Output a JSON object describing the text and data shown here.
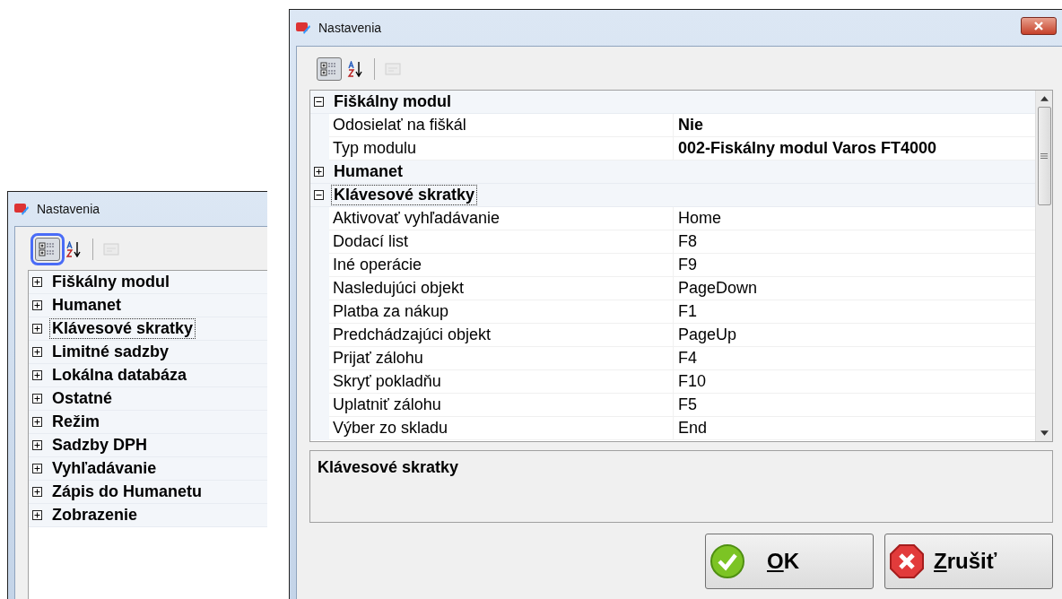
{
  "windows": [
    {
      "title": "Nastavenia",
      "toolbar": [
        {
          "kind": "categorized",
          "selected": true,
          "highlighted": true,
          "disabled": false
        },
        {
          "kind": "alphabetical",
          "selected": false,
          "highlighted": false,
          "disabled": false
        },
        {
          "kind": "pages",
          "selected": false,
          "highlighted": false,
          "disabled": true
        }
      ],
      "categories": [
        {
          "name": "Fiškálny modul",
          "expanded": false,
          "selected": false
        },
        {
          "name": "Humanet",
          "expanded": false,
          "selected": false
        },
        {
          "name": "Klávesové skratky",
          "expanded": false,
          "selected": true
        },
        {
          "name": "Limitné sadzby",
          "expanded": false,
          "selected": false
        },
        {
          "name": "Lokálna databáza",
          "expanded": false,
          "selected": false
        },
        {
          "name": "Ostatné",
          "expanded": false,
          "selected": false
        },
        {
          "name": "Režim",
          "expanded": false,
          "selected": false
        },
        {
          "name": "Sadzby DPH",
          "expanded": false,
          "selected": false
        },
        {
          "name": "Vyhľadávanie",
          "expanded": false,
          "selected": false
        },
        {
          "name": "Zápis do Humanetu",
          "expanded": false,
          "selected": false
        },
        {
          "name": "Zobrazenie",
          "expanded": false,
          "selected": false
        }
      ]
    },
    {
      "title": "Nastavenia",
      "toolbar": [
        {
          "kind": "categorized",
          "selected": true,
          "highlighted": false,
          "disabled": false
        },
        {
          "kind": "alphabetical",
          "selected": false,
          "highlighted": false,
          "disabled": false
        },
        {
          "kind": "pages",
          "selected": false,
          "highlighted": false,
          "disabled": true
        }
      ],
      "categories": [
        {
          "name": "Fiškálny modul",
          "expanded": true,
          "selected": false,
          "properties": [
            {
              "name": "Odosielať na fiškál",
              "value": "Nie",
              "modified": true
            },
            {
              "name": "Typ modulu",
              "value": "002-Fiskálny modul Varos FT4000",
              "modified": true
            }
          ]
        },
        {
          "name": "Humanet",
          "expanded": false,
          "selected": false
        },
        {
          "name": "Klávesové skratky",
          "expanded": true,
          "selected": true,
          "properties": [
            {
              "name": "Aktivovať vyhľadávanie",
              "value": "Home",
              "modified": false
            },
            {
              "name": "Dodací list",
              "value": "F8",
              "modified": false
            },
            {
              "name": "Iné operácie",
              "value": "F9",
              "modified": false
            },
            {
              "name": "Nasledujúci objekt",
              "value": "PageDown",
              "modified": false
            },
            {
              "name": "Platba za nákup",
              "value": "F1",
              "modified": false
            },
            {
              "name": "Predchádzajúci objekt",
              "value": "PageUp",
              "modified": false
            },
            {
              "name": "Prijať zálohu",
              "value": "F4",
              "modified": false
            },
            {
              "name": "Skryť pokladňu",
              "value": "F10",
              "modified": false
            },
            {
              "name": "Uplatniť zálohu",
              "value": "F5",
              "modified": false
            },
            {
              "name": "Výber zo skladu",
              "value": "End",
              "modified": false
            }
          ]
        }
      ],
      "description": {
        "title": "Klávesové skratky"
      },
      "buttons": [
        {
          "kind": "ok",
          "label": "OK"
        },
        {
          "kind": "cancel",
          "label": "Zrušiť"
        }
      ]
    }
  ]
}
